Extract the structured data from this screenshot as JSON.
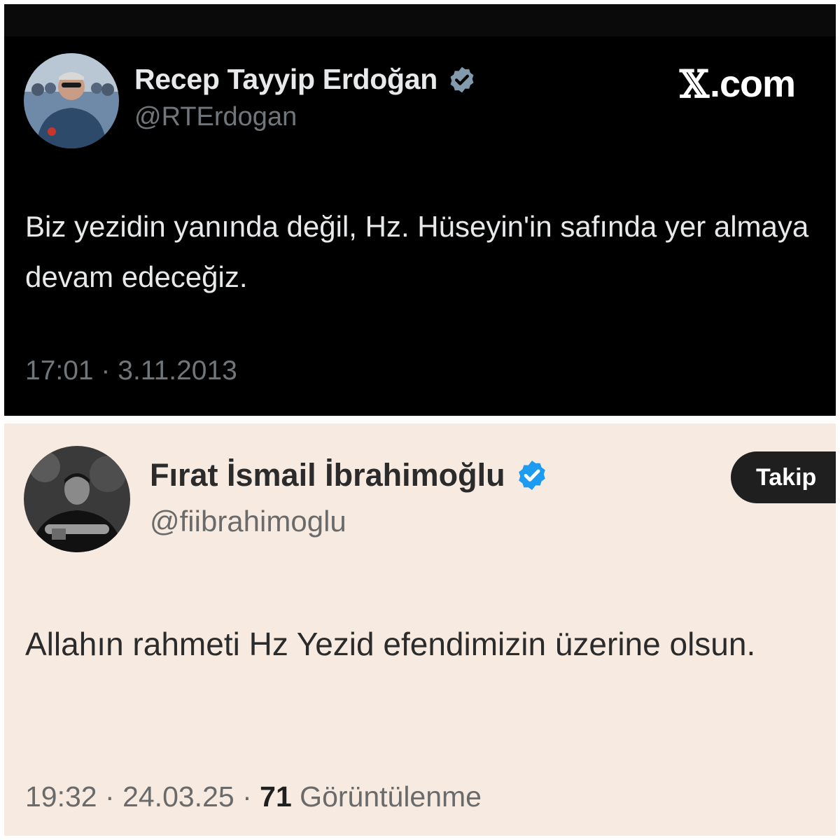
{
  "tweets": [
    {
      "author_name": "Recep Tayyip Erdoğan",
      "handle": "@RTErdogan",
      "verified_badge_color": "#829aab",
      "source_label": ".com",
      "source_icon": "x-logo-icon",
      "text": "Biz yezidin yanında değil, Hz. Hüseyin'in safında yer almaya devam edeceğiz.",
      "timestamp": "17:01 · 3.11.2013",
      "theme": {
        "background": "#000000",
        "text": "#e7e9ea",
        "secondary": "#71767b"
      }
    },
    {
      "author_name": "Fırat İsmail İbrahimoğlu",
      "handle": "@fiibrahimoglu",
      "verified_badge_color": "#1d9bf0",
      "follow_button_label": "Takip",
      "text": "Allahın rahmeti Hz Yezid efendimizin üzerine olsun.",
      "time": "19:32",
      "date": "24.03.25",
      "separator": "·",
      "views_count": "71",
      "views_label": "Görüntülenme",
      "theme": {
        "background": "#f7ebe1",
        "text": "#2b2b2b",
        "secondary": "#6a6a6a"
      }
    }
  ]
}
